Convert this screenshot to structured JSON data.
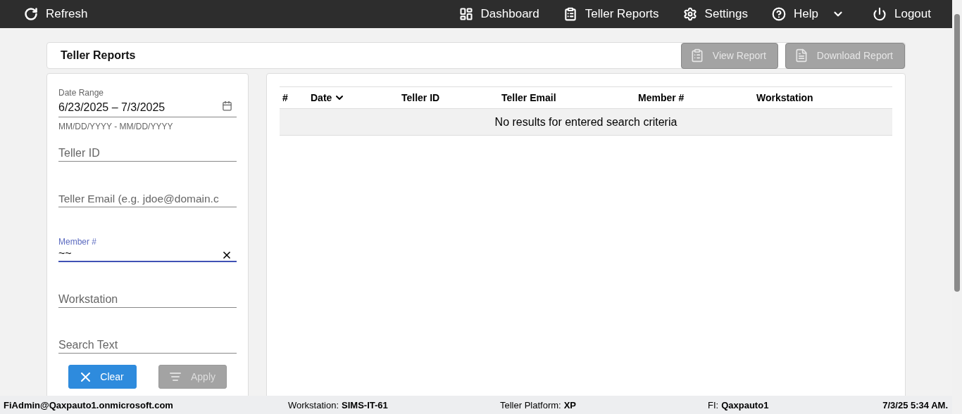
{
  "nav": {
    "refresh": "Refresh",
    "items": [
      {
        "kind": "dashboard",
        "label": "Dashboard",
        "dropdown": false
      },
      {
        "kind": "reports",
        "label": "Teller Reports",
        "dropdown": false
      },
      {
        "kind": "settings",
        "label": "Settings",
        "dropdown": false
      },
      {
        "kind": "help",
        "label": "Help",
        "dropdown": true
      },
      {
        "kind": "logout",
        "label": "Logout",
        "dropdown": false
      }
    ]
  },
  "header": {
    "title": "Teller Reports",
    "buttons": [
      {
        "kind": "view",
        "label": "View Report",
        "disabled": true
      },
      {
        "kind": "pdf",
        "label": "Download Report",
        "disabled": true
      }
    ]
  },
  "filters": {
    "date_range": {
      "label": "Date Range",
      "value": "6/23/2025 – 7/3/2025",
      "hint": "MM/DD/YYYY - MM/DD/YYYY"
    },
    "fields": [
      {
        "placeholder": "Teller ID",
        "focused": false
      },
      {
        "placeholder": "Teller Email (e.g. jdoe@domain.c",
        "focused": false
      },
      {
        "label": "Member #",
        "value": "~~",
        "focused": true
      },
      {
        "placeholder": "Workstation",
        "focused": false
      },
      {
        "placeholder": "Search Text",
        "focused": false
      }
    ],
    "buttons": [
      {
        "kind": "clear",
        "label": "Clear",
        "disabled": false
      },
      {
        "kind": "apply",
        "label": "Apply",
        "disabled": true
      }
    ]
  },
  "table": {
    "columns": [
      {
        "label": "#",
        "sorted": false
      },
      {
        "label": "Date",
        "sorted": true
      },
      {
        "label": "Teller ID",
        "sorted": false
      },
      {
        "label": "Teller Email",
        "sorted": false
      },
      {
        "label": "Member #",
        "sorted": false
      },
      {
        "label": "Workstation",
        "sorted": false
      }
    ],
    "empty_message": "No results for entered search criteria"
  },
  "status_bar": {
    "user": "FiAdmin@Qaxpauto1.onmicrosoft.com",
    "items": [
      {
        "label": "Workstation:",
        "value": "SIMS-IT-61"
      },
      {
        "label": "Teller Platform:",
        "value": "XP"
      },
      {
        "label": "FI:",
        "value": "Qaxpauto1"
      }
    ],
    "time": "7/3/25 5:34 AM."
  }
}
